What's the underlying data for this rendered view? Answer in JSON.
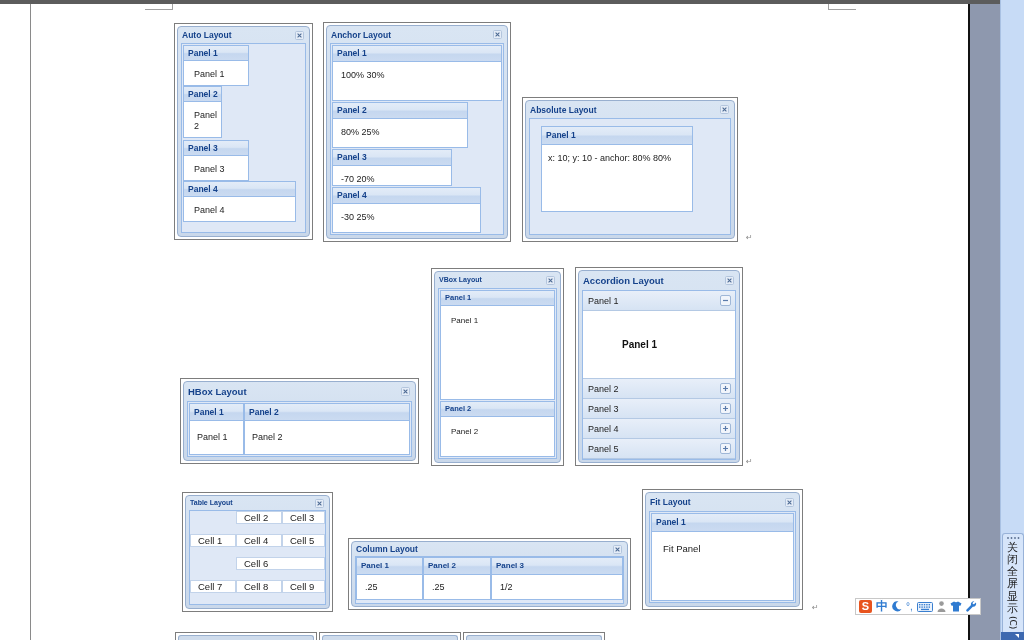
{
  "document": {
    "rows": [
      {
        "windows": [
          {
            "kind": "auto",
            "title": "Auto Layout",
            "panels": [
              {
                "title": "Panel 1",
                "text": "Panel 1"
              },
              {
                "title": "Panel 2",
                "text": "Panel 2"
              },
              {
                "title": "Panel 3",
                "text": "Panel 3"
              },
              {
                "title": "Panel 4",
                "text": "Panel 4"
              }
            ]
          },
          {
            "kind": "anchor",
            "title": "Anchor Layout",
            "panels": [
              {
                "title": "Panel 1",
                "text": "100% 30%"
              },
              {
                "title": "Panel 2",
                "text": "80% 25%"
              },
              {
                "title": "Panel 3",
                "text": "-70 20%"
              },
              {
                "title": "Panel 4",
                "text": "-30 25%"
              }
            ]
          },
          {
            "kind": "absolute",
            "title": "Absolute Layout",
            "panels": [
              {
                "title": "Panel 1",
                "text": "x: 10; y: 10 - anchor: 80% 80%"
              }
            ]
          }
        ],
        "paragraph_mark": "↵"
      },
      {
        "windows": [
          {
            "kind": "hbox",
            "title": "HBox Layout",
            "panels": [
              {
                "title": "Panel 1",
                "text": "Panel 1"
              },
              {
                "title": "Panel 2",
                "text": "Panel 2"
              }
            ]
          },
          {
            "kind": "vbox",
            "title": "VBox Layout",
            "panels": [
              {
                "title": "Panel 1",
                "text": "Panel 1"
              },
              {
                "title": "Panel 2",
                "text": "Panel 2"
              }
            ]
          },
          {
            "kind": "accordion",
            "title": "Accordion Layout",
            "panels": [
              {
                "title": "Panel 1",
                "expanded": true,
                "text": "Panel 1"
              },
              {
                "title": "Panel 2",
                "expanded": false
              },
              {
                "title": "Panel 3",
                "expanded": false
              },
              {
                "title": "Panel 4",
                "expanded": false
              },
              {
                "title": "Panel 5",
                "expanded": false
              }
            ]
          }
        ],
        "paragraph_mark": "↵"
      },
      {
        "windows": [
          {
            "kind": "table",
            "title": "Table Layout",
            "cells": [
              {
                "kind": "gap"
              },
              {
                "kind": "cell",
                "text": "Cell 2"
              },
              {
                "kind": "cell",
                "text": "Cell 3"
              },
              {
                "kind": "cell",
                "text": "Cell 1"
              },
              {
                "kind": "cell",
                "text": "Cell 4"
              },
              {
                "kind": "cell",
                "text": "Cell 5"
              },
              {
                "kind": "gap"
              },
              {
                "kind": "wide",
                "text": "Cell 6"
              },
              {
                "kind": "cell",
                "text": "Cell 7"
              },
              {
                "kind": "cell",
                "text": "Cell 8"
              },
              {
                "kind": "cell",
                "text": "Cell 9"
              }
            ]
          },
          {
            "kind": "column",
            "title": "Column Layout",
            "panels": [
              {
                "title": "Panel 1",
                "text": ".25"
              },
              {
                "title": "Panel 2",
                "text": ".25"
              },
              {
                "title": "Panel 3",
                "text": "1/2"
              }
            ]
          },
          {
            "kind": "fit",
            "title": "Fit Layout",
            "panels": [
              {
                "title": "Panel 1",
                "text": "Fit Panel"
              }
            ]
          }
        ],
        "paragraph_mark": "↵"
      }
    ]
  },
  "ime_toolbar": {
    "logo": "S",
    "mode": "中",
    "punctuation": "°,"
  },
  "side_bar": {
    "button": {
      "label": "关闭全屏显示",
      "shortcut": "(C)"
    }
  }
}
